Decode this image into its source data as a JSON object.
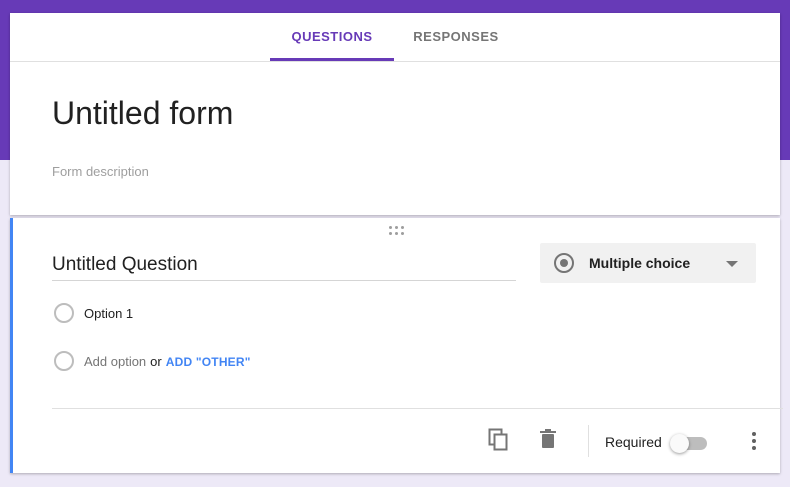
{
  "colors": {
    "accent": "#673ab7",
    "link": "#4285f4",
    "question_border": "#4285f4"
  },
  "tabs": [
    {
      "label": "QUESTIONS",
      "active": true
    },
    {
      "label": "RESPONSES",
      "active": false
    }
  ],
  "form": {
    "title": "Untitled form",
    "description_placeholder": "Form description"
  },
  "question": {
    "title": "Untitled Question",
    "type_label": "Multiple choice",
    "type_icon": "radio-button-icon",
    "options": [
      {
        "label": "Option 1"
      }
    ],
    "add_option_placeholder": "Add option",
    "or_text": "or",
    "add_other_label": "ADD \"OTHER\"",
    "footer": {
      "duplicate_icon": "copy-icon",
      "delete_icon": "trash-icon",
      "required_label": "Required",
      "required_on": false,
      "more_icon": "more-vert-icon"
    }
  }
}
